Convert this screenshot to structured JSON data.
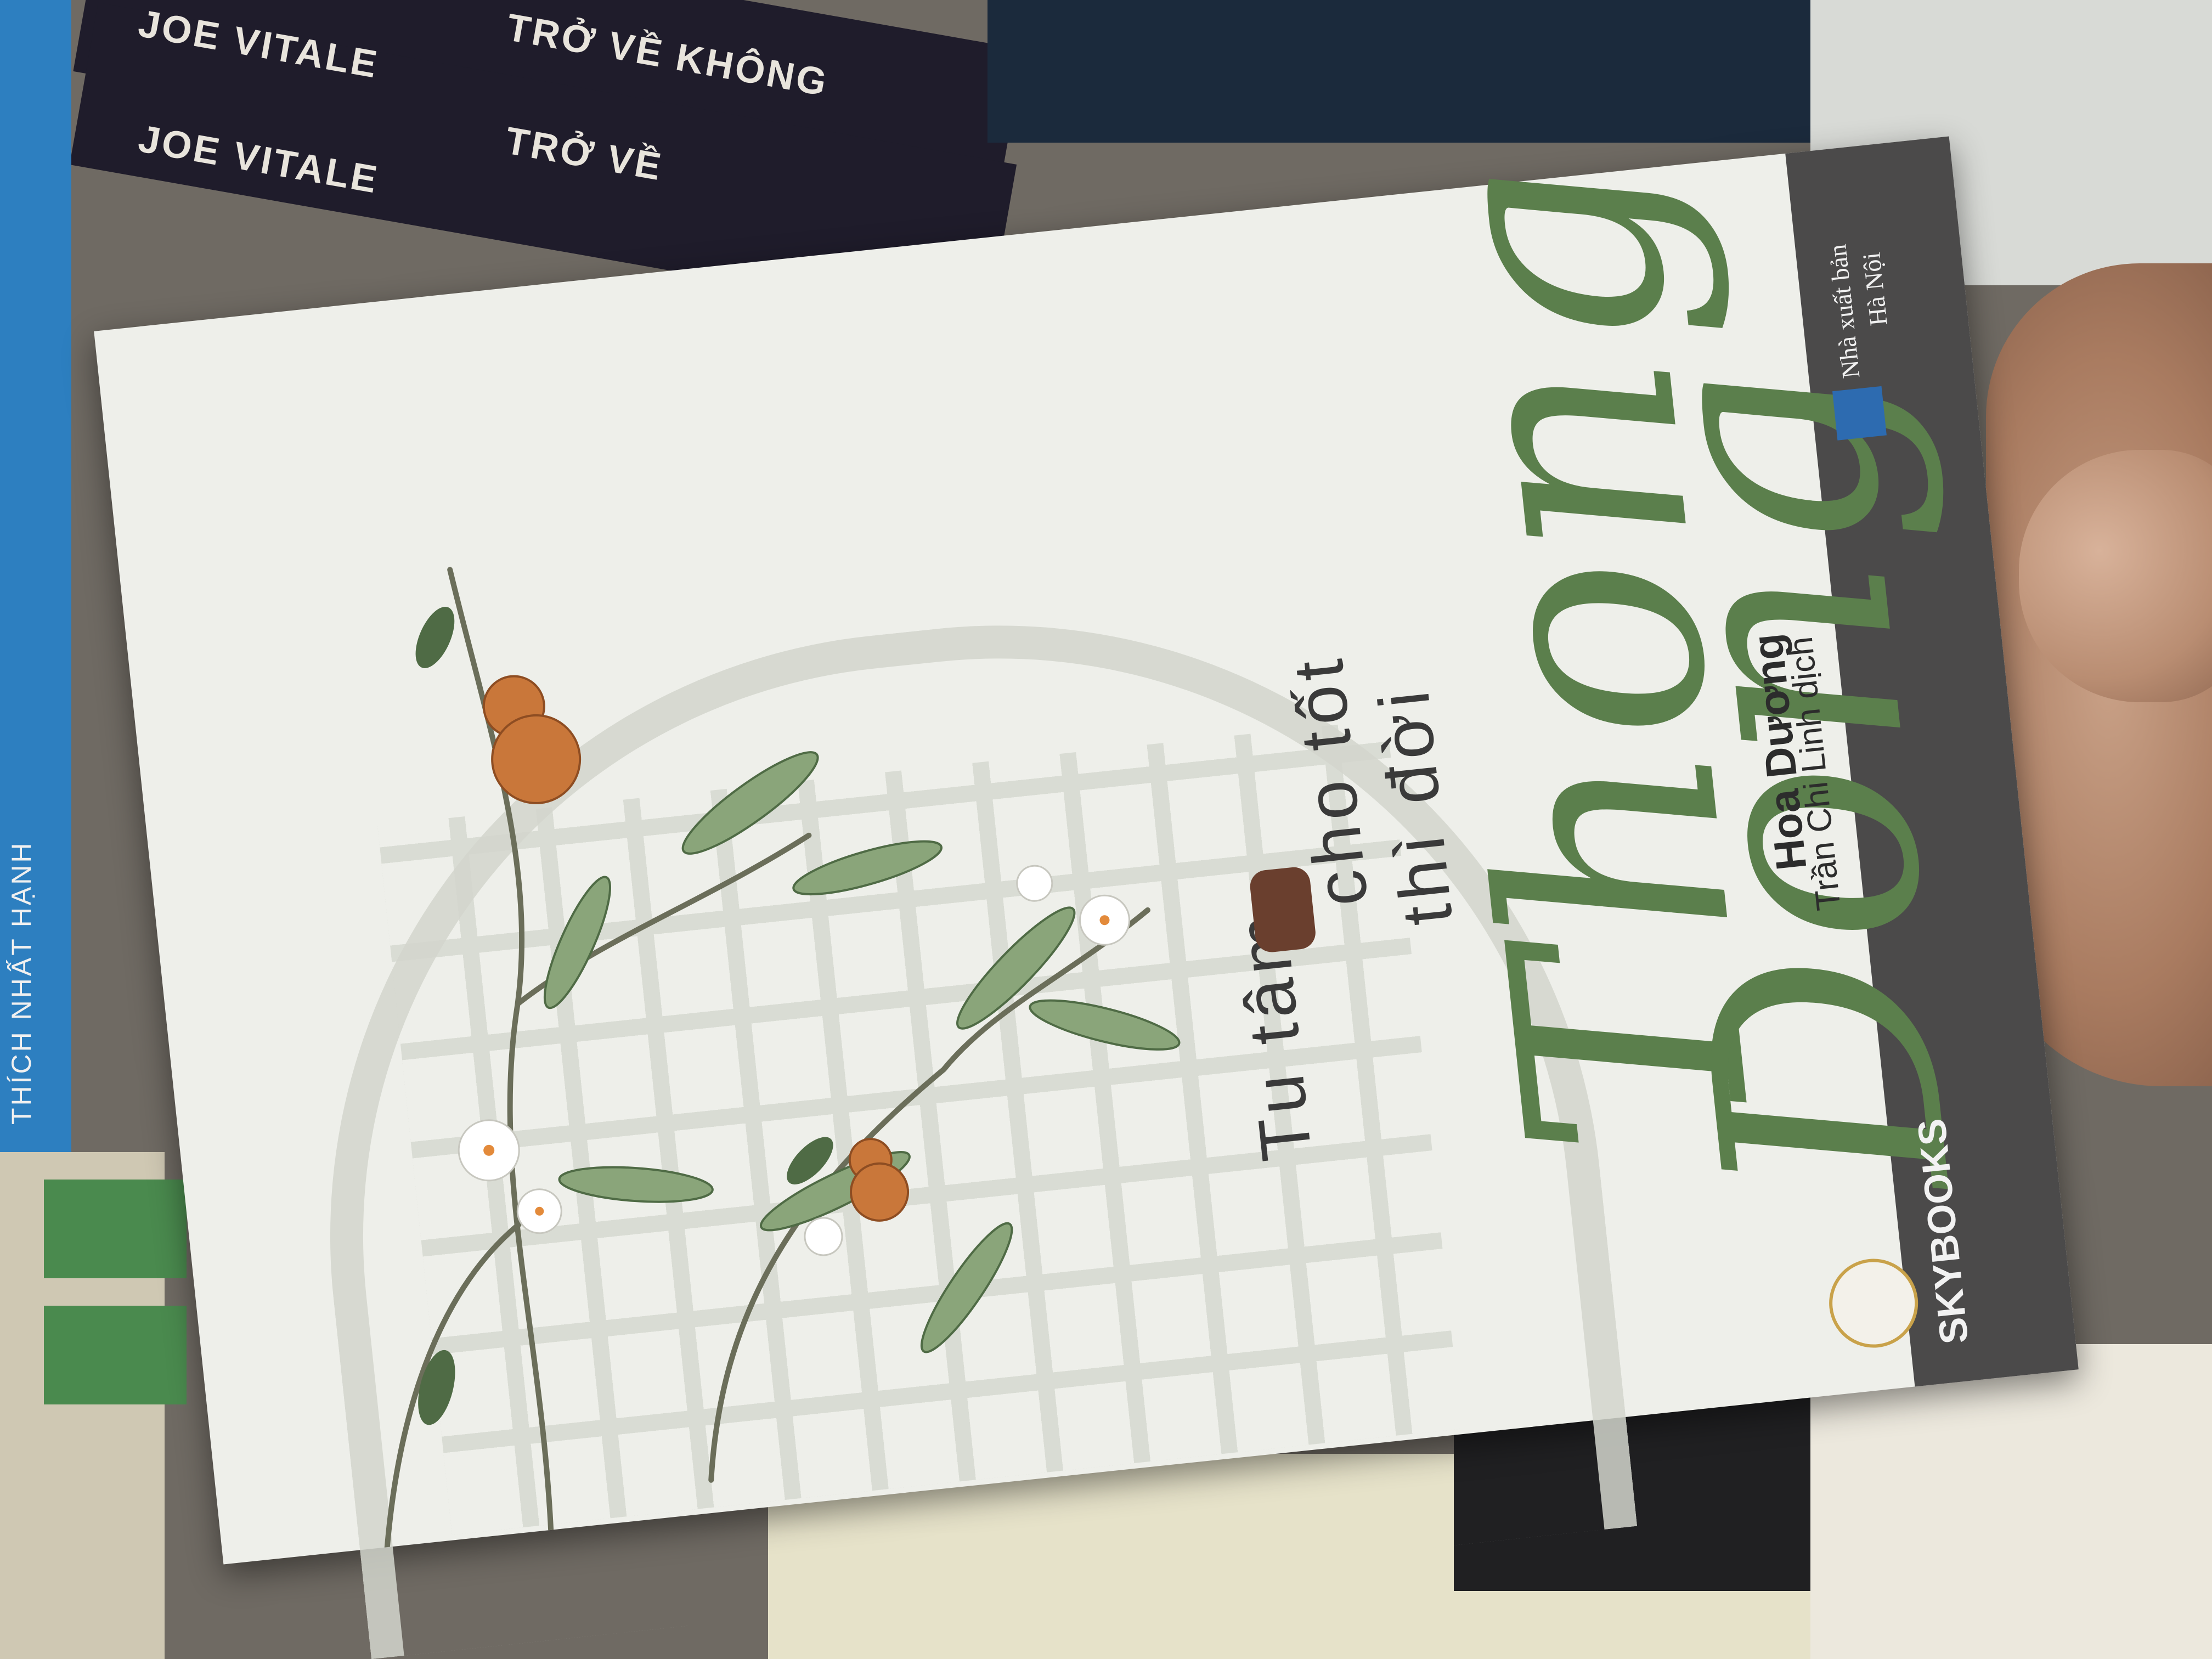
{
  "background_books": {
    "spine_1": "JOE VITALE",
    "spine_2": "JOE VITALE",
    "spine_3": "TRỞ VỀ KHÔNG",
    "spine_4": "TRỞ VỀ",
    "spine_left": "THÍCH NHẤT HẠNH"
  },
  "cover": {
    "subtitle_line_1": "Tu tâm",
    "subtitle_line_2": "cho tốt",
    "subtitle_line_3": "thì đời",
    "title_word_1": "Thong",
    "title_word_2": "Dong",
    "author": "Hoa Dương",
    "translator": "Trần Chi Linh dịch",
    "publisher_line_1": "Nhà xuất bản",
    "publisher_line_2": "Hà Nội",
    "imprint": "SKYBOOKS"
  },
  "colors": {
    "title_green": "#5b7f4c",
    "cover_bg": "#eeefea",
    "side_band": "#4b4a4a",
    "lattice": "#d3d6cd",
    "fruit": "#c9773a"
  }
}
